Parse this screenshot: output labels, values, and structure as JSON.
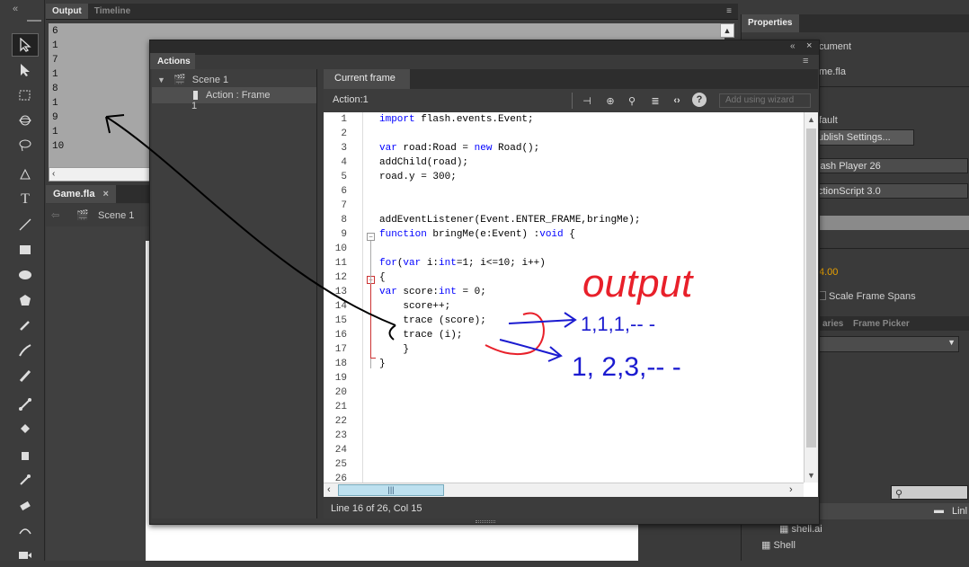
{
  "output_panel": {
    "tabs": [
      "Output",
      "Timeline"
    ],
    "lines": [
      "6",
      "1",
      "7",
      "1",
      "8",
      "1",
      "9",
      "1",
      "10"
    ]
  },
  "document": {
    "tab_label": "Game.fla",
    "scene_label": "Scene 1"
  },
  "properties": {
    "tab_label": "Properties",
    "document_partial": "cument",
    "file_partial": "me.fla",
    "profile_partial": "fault",
    "publish_button_partial": "ublish Settings...",
    "target_partial": "lash Player 26",
    "script_partial": "ctionScript 3.0",
    "fps_partial": "4.00",
    "scale_label": "Scale Frame Spans",
    "lib_tabs": [
      "aries",
      "Frame Picker"
    ],
    "lib_link_partial": "Linl",
    "lib_items": [
      "shell.ai",
      "Shell"
    ]
  },
  "actions_panel": {
    "tab_label": "Actions",
    "tree": [
      {
        "label": "Scene 1"
      },
      {
        "label": "Action : Frame 1"
      }
    ],
    "code_tab": "Current frame",
    "action_label": "Action:1",
    "wizard_button": "Add using wizard",
    "status": "Line 16 of 26, Col 15",
    "code_lines": [
      {
        "n": "1",
        "t": "import flash.events.Event;"
      },
      {
        "n": "2",
        "t": ""
      },
      {
        "n": "3",
        "t": "var road:Road = new Road();"
      },
      {
        "n": "4",
        "t": "addChild(road);"
      },
      {
        "n": "5",
        "t": "road.y = 300;"
      },
      {
        "n": "6",
        "t": ""
      },
      {
        "n": "7",
        "t": ""
      },
      {
        "n": "8",
        "t": "addEventListener(Event.ENTER_FRAME,bringMe);"
      },
      {
        "n": "9",
        "t": "function bringMe(e:Event) :void {"
      },
      {
        "n": "10",
        "t": ""
      },
      {
        "n": "11",
        "t": "for(var i:int=1; i<=10; i++)"
      },
      {
        "n": "12",
        "t": "{"
      },
      {
        "n": "13",
        "t": "var score:int = 0;"
      },
      {
        "n": "14",
        "t": "    score++;"
      },
      {
        "n": "15",
        "t": "    trace (score);"
      },
      {
        "n": "16",
        "t": "    trace (i);"
      },
      {
        "n": "17",
        "t": "    }"
      },
      {
        "n": "18",
        "t": "}"
      },
      {
        "n": "19",
        "t": ""
      },
      {
        "n": "20",
        "t": ""
      },
      {
        "n": "21",
        "t": ""
      },
      {
        "n": "22",
        "t": ""
      },
      {
        "n": "23",
        "t": ""
      },
      {
        "n": "24",
        "t": ""
      },
      {
        "n": "25",
        "t": ""
      },
      {
        "n": "26",
        "t": ""
      }
    ]
  },
  "annotations": {
    "word": "output",
    "series_a": "1,1,1,-- -",
    "series_b": "1, 2,3,-- -"
  },
  "colors": {
    "annotation_red": "#e8202a",
    "annotation_blue": "#1b1bd0",
    "keyword_blue": "#0000ff"
  }
}
